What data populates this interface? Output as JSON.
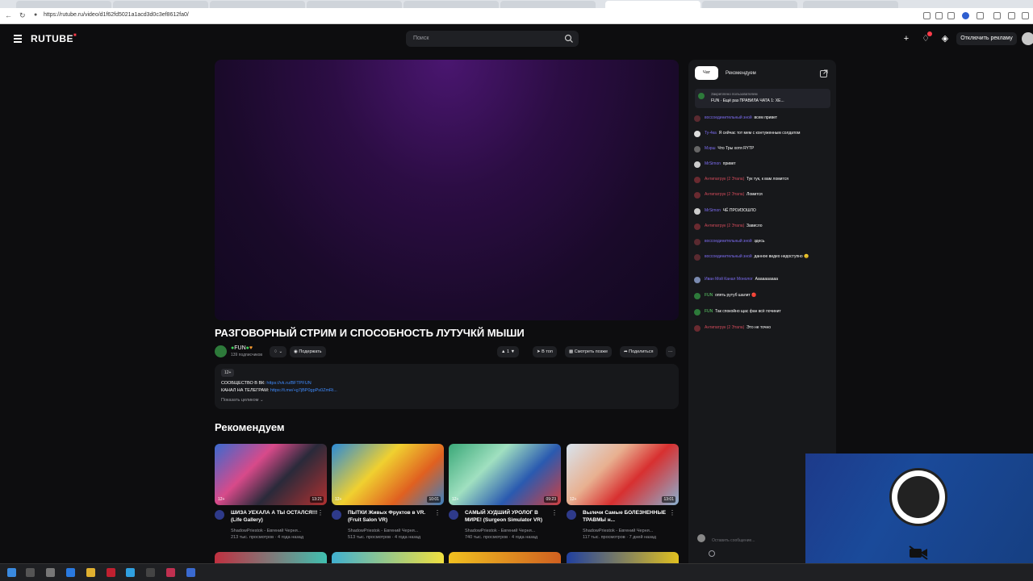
{
  "browser": {
    "url": "https://rutube.ru/video/d1f62fd5021a1acd3d0c3ef8612fa0/"
  },
  "header": {
    "logo": "RUTUBE",
    "search_placeholder": "Поиск",
    "ad_button": "Отключить рекламу"
  },
  "video": {
    "title": "РАЗГОВОРНЫЙ СТРИМ И СПОСОБНОСТЬ ЛУТУЧКЙ МЫШИ",
    "channel": "FUN",
    "subscribers": "139 подписчиков",
    "support_label": "Подержать",
    "likes": "1",
    "to_top_label": "В топ",
    "watch_later_label": "Смотреть позже",
    "share_label": "Поделиться"
  },
  "description": {
    "age": "12+",
    "vk_label": "СООБЩЕСТВО В ВК:",
    "vk_link": "https://vk.ru/BFTPFUN",
    "tg_label": "КАНАЛ НА ТЕЛЕГРАМ:",
    "tg_link": "https://t.me/+g7jBP0gpPs0ZmRi...",
    "show_all": "Показать целиком"
  },
  "recommended": {
    "heading": "Рекомендуем",
    "cards": [
      {
        "title": "ШИЗА УЕХАЛА А ТЫ ОСТАЛСЯ!!! (Life Gallery)",
        "author": "ShadowPriestok - Евгений Черня...",
        "stats": "213 тыс. просмотров · 4 года назад",
        "age": "12+",
        "duration": "13:21"
      },
      {
        "title": "ПЫТКИ Живых Фруктов в VR. (Fruit Salon VR)",
        "author": "ShadowPriestok - Евгений Черня...",
        "stats": "513 тыс. просмотров · 4 года назад",
        "age": "12+",
        "duration": "10:01"
      },
      {
        "title": "САМЫЙ ХУДШИЙ УРОЛОГ В МИРЕ! (Surgeon Simulator VR)",
        "author": "ShadowPriestok - Евгений Черня...",
        "stats": "740 тыс. просмотров · 4 года назад",
        "age": "12+",
        "duration": "09:23"
      },
      {
        "title": "Вылечи Самые БОЛЕЗНЕННЫЕ ТРАВМЫ н...",
        "author": "ShadowPriestok - Евгений Черня...",
        "stats": "117 тыс. просмотров · 7 дней назад",
        "age": "12+",
        "duration": "13:01"
      }
    ]
  },
  "chat": {
    "tab_chat": "Чат",
    "tab_recommended": "Рекомендуем",
    "pinned_label": "Закреплено пользователем",
    "pinned_text": "FUN · Ещё раз ПРАВИЛА ЧАТА 1: ХЕ...",
    "messages": [
      {
        "user": "воссоединительный зной",
        "text": "всем привет",
        "color": "purple"
      },
      {
        "user": "Ту-4ка",
        "text": "Я сейчас тот мем с контуженным солдатом",
        "color": "purple"
      },
      {
        "user": "Мэрш",
        "text": "Что Тры хотя RYTP",
        "color": "purple"
      },
      {
        "user": "MrSimon",
        "text": "привет",
        "color": "purple"
      },
      {
        "user": "Антипатрук (2 Этапа)",
        "text": "Тук тук, к вам ломится",
        "color": "red"
      },
      {
        "user": "Антипатрук (2 Этапа)",
        "text": "Ломится",
        "color": "red"
      },
      {
        "user": "MrSimon",
        "text": "ЧЁ ПРОИЗОШЛО",
        "color": "purple"
      },
      {
        "user": "Антипатрук (2 Этапа)",
        "text": "Зависло",
        "color": "red"
      },
      {
        "user": "воссоединительный зной",
        "text": "здесь",
        "color": "purple"
      },
      {
        "user": "воссоединительный зной",
        "text": "данное видео недоступно 😐",
        "color": "purple"
      },
      {
        "user": "Иван Мой Канал Монолог",
        "text": "Аааааааааа",
        "color": "purple"
      },
      {
        "user": "FUN",
        "text": "опять рутуб шалит 🔴",
        "color": "green"
      },
      {
        "user": "FUN",
        "text": "Так спокойно щас фан всё починит",
        "color": "green"
      },
      {
        "user": "Антипатрук (2 Этапа)",
        "text": "Это не точно",
        "color": "red"
      }
    ],
    "input_placeholder": "Оставить сообщение..."
  },
  "colors": {
    "accent": "#ff3c4b",
    "link": "#3f8cff",
    "obs_blue": "#1d3a8a"
  }
}
